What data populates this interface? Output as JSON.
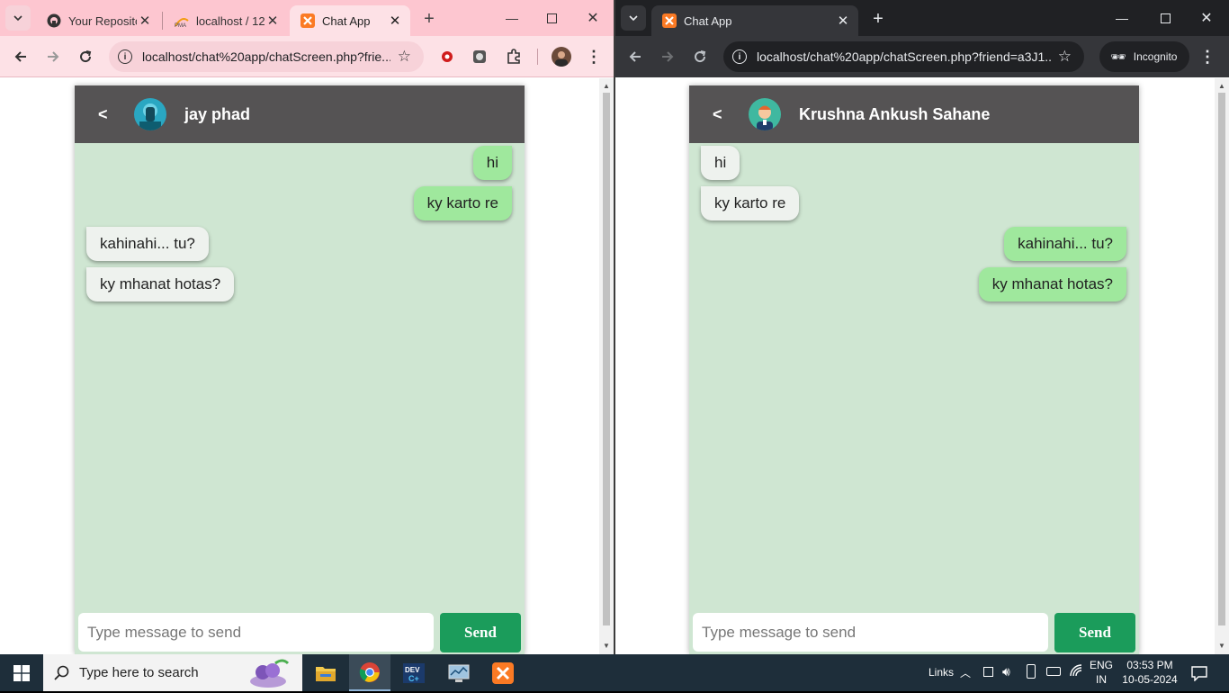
{
  "left_window": {
    "tabs": [
      {
        "title": "Your Reposito",
        "icon": "github-icon"
      },
      {
        "title": "localhost / 12",
        "icon": "phpmyadmin-icon"
      },
      {
        "title": "Chat App",
        "icon": "xampp-icon",
        "active": true
      }
    ],
    "url": "localhost/chat%20app/chatScreen.php?frie...",
    "chat": {
      "back_label": "<",
      "friend_name": "jay phad",
      "messages": [
        {
          "text": "hi",
          "direction": "sent"
        },
        {
          "text": "ky karto re",
          "direction": "sent"
        },
        {
          "text": "kahinahi... tu?",
          "direction": "received"
        },
        {
          "text": "ky mhanat hotas?",
          "direction": "received"
        }
      ],
      "input_placeholder": "Type message to send",
      "send_label": "Send"
    }
  },
  "right_window": {
    "tabs": [
      {
        "title": "Chat App",
        "icon": "xampp-icon",
        "active": true
      }
    ],
    "url": "localhost/chat%20app/chatScreen.php?friend=a3J1...",
    "incognito_label": "Incognito",
    "chat": {
      "back_label": "<",
      "friend_name": "Krushna Ankush Sahane",
      "messages": [
        {
          "text": "hi",
          "direction": "received"
        },
        {
          "text": "ky karto re",
          "direction": "received"
        },
        {
          "text": "kahinahi... tu?",
          "direction": "sent"
        },
        {
          "text": "ky mhanat hotas?",
          "direction": "sent"
        }
      ],
      "input_placeholder": "Type message to send",
      "send_label": "Send"
    }
  },
  "taskbar": {
    "search_placeholder": "Type here to search",
    "links_label": "Links",
    "language_top": "ENG",
    "language_bottom": "IN",
    "time": "03:53 PM",
    "date": "10-05-2024"
  },
  "colors": {
    "chat_bg": "#cfe6d2",
    "header_bg": "#555354",
    "sent_bubble": "#9fe89d",
    "received_bubble": "#eef2ee",
    "send_button": "#1b9c5b",
    "left_tabstrip": "#fdc6d0",
    "right_tabstrip": "#202124"
  }
}
